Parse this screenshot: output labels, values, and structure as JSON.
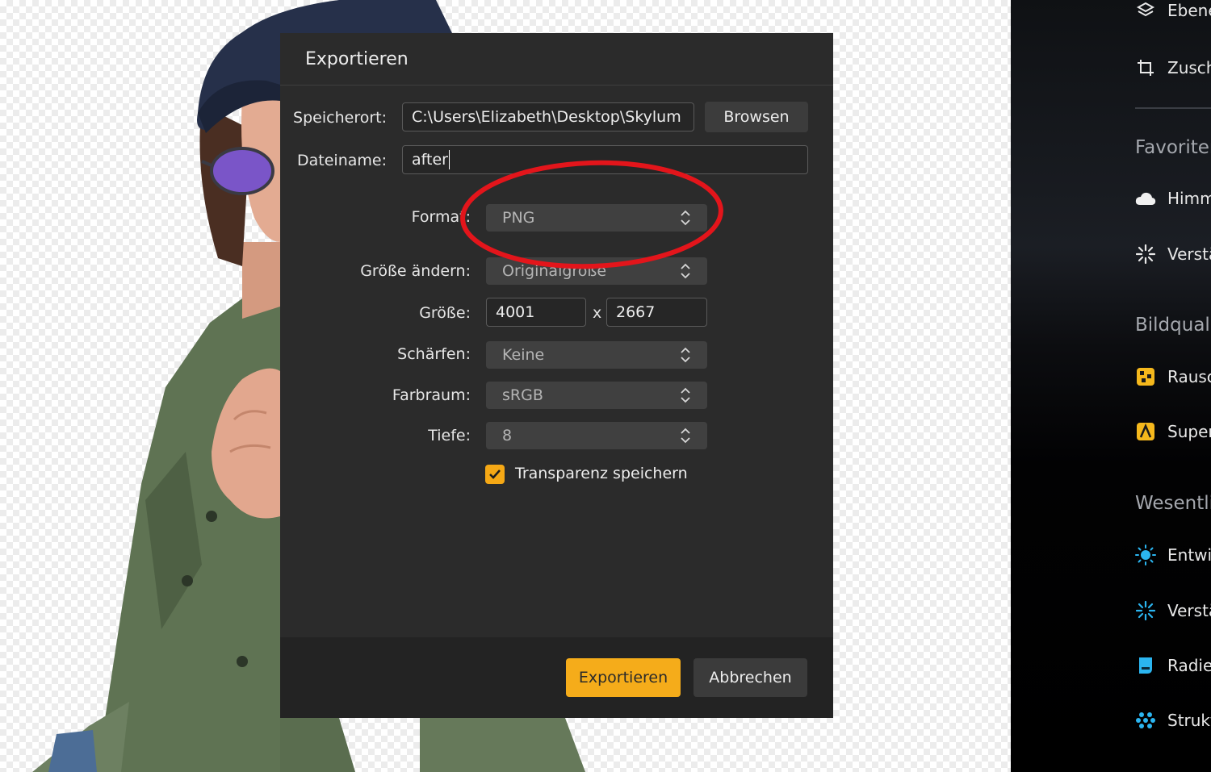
{
  "sidebar": {
    "items": [
      {
        "label": "Ebene",
        "icon": "layers-icon"
      },
      {
        "label": "Zusch",
        "icon": "crop-icon"
      },
      {
        "label": "Himm",
        "icon": "cloud-icon"
      },
      {
        "label": "Verstä",
        "icon": "sparkle-icon"
      },
      {
        "label": "Rausc",
        "icon": "noise-icon"
      },
      {
        "label": "Super",
        "icon": "super-icon"
      },
      {
        "label": "Entwi",
        "icon": "sun-icon"
      },
      {
        "label": "Verstä",
        "icon": "sparkle-icon"
      },
      {
        "label": "Radie",
        "icon": "eraser-icon"
      },
      {
        "label": "Strukt",
        "icon": "structure-icon"
      }
    ],
    "sections": [
      "Favoriten",
      "Bildquali",
      "Wesentli"
    ]
  },
  "dialog": {
    "title": "Exportieren",
    "location_label": "Speicherort:",
    "location_value": "C:\\Users\\Elizabeth\\Desktop\\Skylum",
    "browse_label": "Browsen",
    "filename_label": "Dateiname:",
    "filename_value": "after",
    "format_label": "Format:",
    "format_value": "PNG",
    "resize_label": "Größe ändern:",
    "resize_value": "Originalgröße",
    "size_label": "Größe:",
    "width_value": "4001",
    "size_separator": "x",
    "height_value": "2667",
    "sharpen_label": "Schärfen:",
    "sharpen_value": "Keine",
    "colorspace_label": "Farbraum:",
    "colorspace_value": "sRGB",
    "depth_label": "Tiefe:",
    "depth_value": "8",
    "transparency_label": "Transparenz speichern",
    "transparency_checked": true,
    "export_button": "Exportieren",
    "cancel_button": "Abbrechen"
  },
  "colors": {
    "accent": "#f5ac1a",
    "annotation": "#e3151b",
    "dialog_bg": "#2b2b2b"
  }
}
